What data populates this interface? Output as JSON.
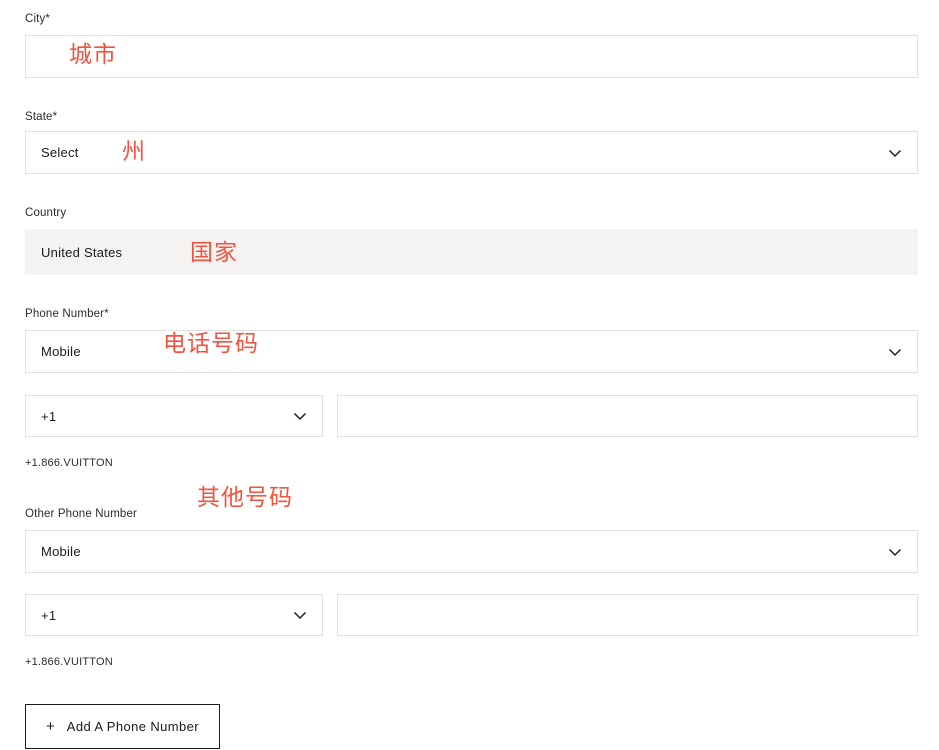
{
  "form": {
    "fields": [
      {
        "name": "city",
        "label": "City*",
        "value": "",
        "type": "text",
        "annotation": "城市"
      },
      {
        "name": "state",
        "label": "State*",
        "value": "Select",
        "type": "select",
        "annotation": "州"
      },
      {
        "name": "country",
        "label": "Country",
        "value": "United States",
        "type": "readonly",
        "annotation": "国家"
      },
      {
        "name": "phone-number",
        "label": "Phone Number*",
        "value": "Mobile",
        "type": "select",
        "annotation": "电话号码"
      },
      {
        "name": "other-phone-number",
        "label": "Other Phone Number",
        "value": "Mobile",
        "type": "select",
        "annotation": "其他号码"
      }
    ],
    "phone_rows": [
      {
        "name": "phone-primary",
        "country_code": "+1",
        "number": "",
        "hint": "+1.866.VUITTON"
      },
      {
        "name": "phone-other",
        "country_code": "+1",
        "number": "",
        "hint": "+1.866.VUITTON"
      }
    ],
    "add_phone_button": {
      "plus": "+",
      "label": "Add A Phone Number"
    }
  },
  "colors": {
    "annotation": "#f4533f",
    "border": "#e3e1df",
    "readonly_bg": "#f5f3f1",
    "text": "#1a1a1a",
    "button_border": "#1a1a1a"
  }
}
